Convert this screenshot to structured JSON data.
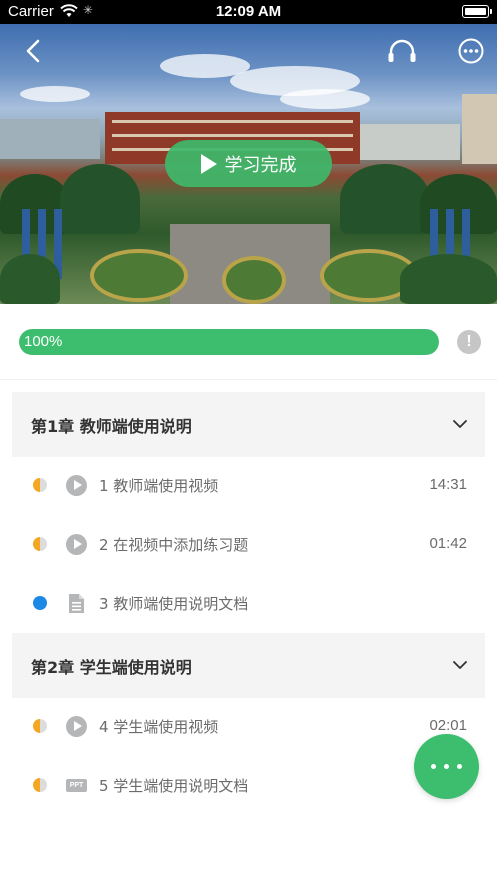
{
  "status_bar": {
    "carrier": "Carrier",
    "time": "12:09 AM"
  },
  "hero": {
    "complete_label": "学习完成"
  },
  "progress": {
    "value": 100,
    "label": "100%"
  },
  "chapters": [
    {
      "title": "第1章  教师端使用说明",
      "lessons": [
        {
          "label": "1  教师端使用视频",
          "duration": "14:31",
          "type": "video",
          "status": "half"
        },
        {
          "label": "2  在视频中添加练习题",
          "duration": "01:42",
          "type": "video",
          "status": "half"
        },
        {
          "label": "3  教师端使用说明文档",
          "duration": "",
          "type": "document",
          "status": "full"
        }
      ]
    },
    {
      "title": "第2章  学生端使用说明",
      "lessons": [
        {
          "label": "4  学生端使用视频",
          "duration": "02:01",
          "type": "video",
          "status": "half"
        },
        {
          "label": "5  学生端使用说明文档",
          "duration": "",
          "type": "ppt",
          "status": "half",
          "icon_text": "PPT"
        }
      ]
    }
  ],
  "icons": {
    "back": "chevron-left-icon",
    "headset": "headset-icon",
    "more": "more-circle-icon",
    "info": "info-icon",
    "info_glyph": "!",
    "expand": "chevron-down-icon",
    "video": "play-circle-icon",
    "document": "document-icon",
    "ppt": "ppt-icon",
    "fab": "more-horizontal-icon"
  },
  "colors": {
    "accent": "#3dbe6f",
    "in_progress": "#f5a623",
    "completed": "#1e88e5"
  }
}
